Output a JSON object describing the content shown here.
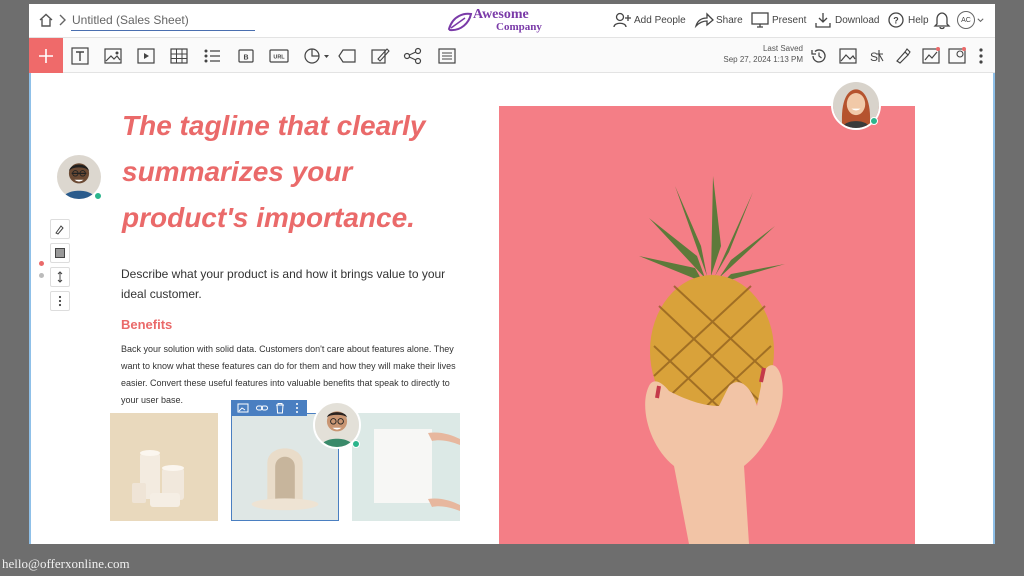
{
  "window": {
    "doc_title": "Untitled (Sales Sheet)",
    "logo_line1": "Awesome",
    "logo_line2": "Company"
  },
  "header_actions": {
    "add_people": "Add People",
    "share": "Share",
    "present": "Present",
    "download": "Download",
    "help": "Help",
    "avatar_initials": "AC"
  },
  "toolbar": {
    "last_saved_label": "Last Saved",
    "last_saved_time": "Sep 27, 2024 1:13 PM"
  },
  "content": {
    "tagline": "The tagline that clearly summarizes your product's importance.",
    "description": "Describe what your product is and how it brings value to your ideal customer.",
    "benefits_heading": "Benefits",
    "benefits_body": "Back your solution with solid data. Customers don't care about features alone. They want to know what these features can do for them and how they will make their lives easier. Convert these useful features into valuable benefits that speak to directly to your user base."
  },
  "footer": {
    "email": "hello@offerxonline.com"
  },
  "colors": {
    "accent": "#ea6a6a",
    "brand": "#7a3aa8",
    "hero_bg": "#f47e86",
    "online": "#2bb58c",
    "selection": "#4a7fc1"
  }
}
